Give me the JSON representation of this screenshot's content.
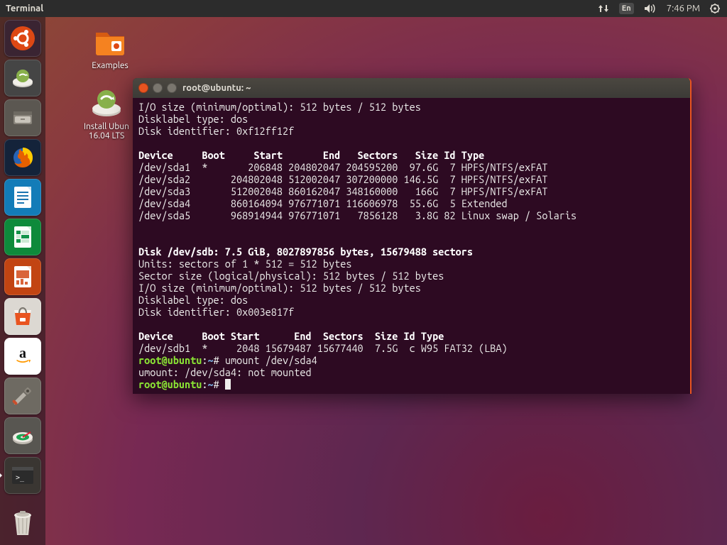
{
  "menubar": {
    "app_title": "Terminal",
    "ime": "En",
    "clock": "7:46 PM"
  },
  "launcher": {
    "tiles": [
      {
        "name": "dash",
        "bg": "#3a2432"
      },
      {
        "name": "ubiquity",
        "bg": "#454545"
      },
      {
        "name": "files",
        "bg": "#5b5751"
      },
      {
        "name": "firefox",
        "bg": "#1a3a66"
      },
      {
        "name": "writer",
        "bg": "#167bb8"
      },
      {
        "name": "calc",
        "bg": "#0e8a3b"
      },
      {
        "name": "impress",
        "bg": "#c24412"
      },
      {
        "name": "software",
        "bg": "#d9d4cf"
      },
      {
        "name": "amazon",
        "bg": "#ffffff"
      },
      {
        "name": "settings",
        "bg": "#6e6a62"
      },
      {
        "name": "gparted",
        "bg": "#585651"
      },
      {
        "name": "terminal",
        "bg": "#3a3632",
        "active": true
      }
    ]
  },
  "desktop": {
    "examples": {
      "label": "Examples"
    },
    "install": {
      "label1": "Install Ubun",
      "label2": "16.04 LTS"
    }
  },
  "terminal": {
    "title": "root@ubuntu: ~",
    "io_size": "I/O size (minimum/optimal): 512 bytes / 512 bytes",
    "disklabel": "Disklabel type: dos",
    "diskid_a": "Disk identifier: 0xf12ff12f",
    "hdr_a": "Device     Boot     Start       End   Sectors   Size Id Type",
    "rows_a": [
      "/dev/sda1  *       206848 204802047 204595200  97.6G  7 HPFS/NTFS/exFAT",
      "/dev/sda2       204802048 512002047 307200000 146.5G  7 HPFS/NTFS/exFAT",
      "/dev/sda3       512002048 860162047 348160000   166G  7 HPFS/NTFS/exFAT",
      "/dev/sda4       860164094 976771071 116606978  55.6G  5 Extended",
      "/dev/sda5       968914944 976771071   7856128   3.8G 82 Linux swap / Solaris"
    ],
    "disk_b_hdr": "Disk /dev/sdb: 7.5 GiB, 8027897856 bytes, 15679488 sectors",
    "units": "Units: sectors of 1 * 512 = 512 bytes",
    "sector_size": "Sector size (logical/physical): 512 bytes / 512 bytes",
    "io_size_b": "I/O size (minimum/optimal): 512 bytes / 512 bytes",
    "disklabel_b": "Disklabel type: dos",
    "diskid_b": "Disk identifier: 0x003e817f",
    "hdr_b": "Device     Boot Start      End  Sectors  Size Id Type",
    "rows_b": [
      "/dev/sdb1  *     2048 15679487 15677440  7.5G  c W95 FAT32 (LBA)"
    ],
    "cmd1": "umount /dev/sda4",
    "resp1": "umount: /dev/sda4: not mounted",
    "prompt_user": "root@ubuntu",
    "prompt_sep": ":",
    "prompt_path": "~",
    "prompt_sym": "#"
  }
}
